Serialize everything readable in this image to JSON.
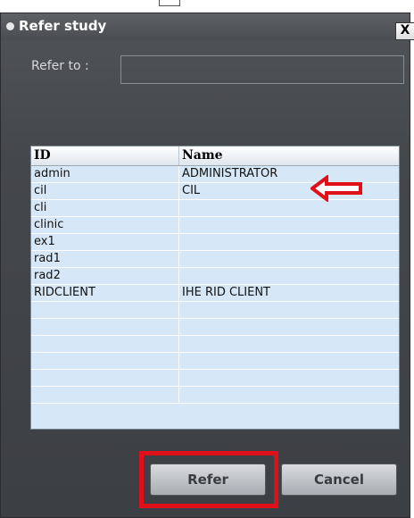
{
  "dialog": {
    "title": "Refer study",
    "close_label": "X",
    "refer_to_label": "Refer to :",
    "refer_to_value": ""
  },
  "grid": {
    "columns": [
      "ID",
      "Name"
    ],
    "rows": [
      {
        "id": "admin",
        "name": "ADMINISTRATOR"
      },
      {
        "id": "cil",
        "name": "CIL"
      },
      {
        "id": "cli",
        "name": ""
      },
      {
        "id": "clinic",
        "name": ""
      },
      {
        "id": "ex1",
        "name": ""
      },
      {
        "id": "rad1",
        "name": ""
      },
      {
        "id": "rad2",
        "name": ""
      },
      {
        "id": "RIDCLIENT",
        "name": "IHE RID CLIENT"
      },
      {
        "id": "",
        "name": ""
      },
      {
        "id": "",
        "name": ""
      },
      {
        "id": "",
        "name": ""
      },
      {
        "id": "",
        "name": ""
      },
      {
        "id": "",
        "name": ""
      },
      {
        "id": "",
        "name": ""
      }
    ]
  },
  "buttons": {
    "refer": "Refer",
    "cancel": "Cancel"
  },
  "annotations": {
    "arrow_color": "#e0101a",
    "highlight_color": "#e0101a"
  }
}
